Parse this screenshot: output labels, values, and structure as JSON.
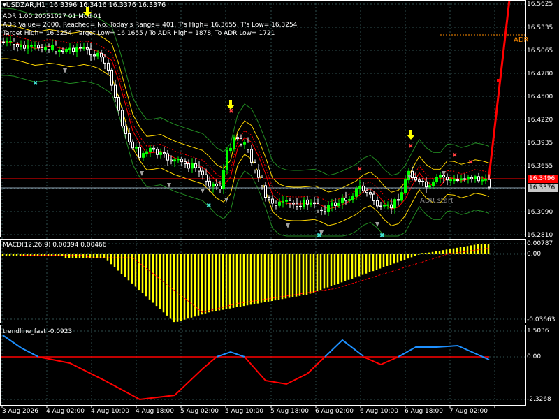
{
  "chart_title": "USDZAR,H1",
  "ohlc": "16.3396 16.3416 16.3376 16.3376",
  "adr_info": {
    "line1": "ADR 1.00 20051027 01 Mod 01",
    "line2": "ADR Value= 2000, Reached= No, Today's Range= 401, T's High= 16.3655, T's Low= 16.3254",
    "line3": "Target High= 16.5254, Target Low= 16.1655 / To ADR High= 1878, To ADR Low= 1721"
  },
  "adr_tag": "ADR",
  "adr_start_label": "ADR start",
  "price_axis": [
    "16.5625",
    "16.5335",
    "16.5065",
    "16.4780",
    "16.4500",
    "16.4220",
    "16.3935",
    "16.3655",
    "16.3090",
    "16.2810"
  ],
  "current_price_red": "16.3496",
  "current_price_gray": "16.3376",
  "macd": {
    "label": "MACD(12,26,9) 0.00394 0.00466",
    "axis": [
      "0.00787",
      "0.00",
      "-0.03663"
    ]
  },
  "trendline": {
    "label": "trendline_fast -0.0923",
    "axis": [
      "1.5036",
      "0.00",
      "-2.3268"
    ]
  },
  "time_axis": [
    "3 Aug 2026",
    "4 Aug 02:00",
    "4 Aug 10:00",
    "4 Aug 18:00",
    "5 Aug 02:00",
    "5 Aug 10:00",
    "5 Aug 18:00",
    "6 Aug 02:00",
    "6 Aug 10:00",
    "6 Aug 18:00",
    "7 Aug 02:00"
  ],
  "colors": {
    "background": "#000000",
    "grid": "#2f4f4f",
    "candle_up": "#00ff00",
    "candle_down": "#ffffff",
    "bands_outer": "#228b22",
    "bands_mid": "#ffd700",
    "fast_ma": "#ff0000",
    "macd_hist": "#ffff00",
    "trend_up": "#1e90ff",
    "trend_down": "#ff0000"
  }
}
